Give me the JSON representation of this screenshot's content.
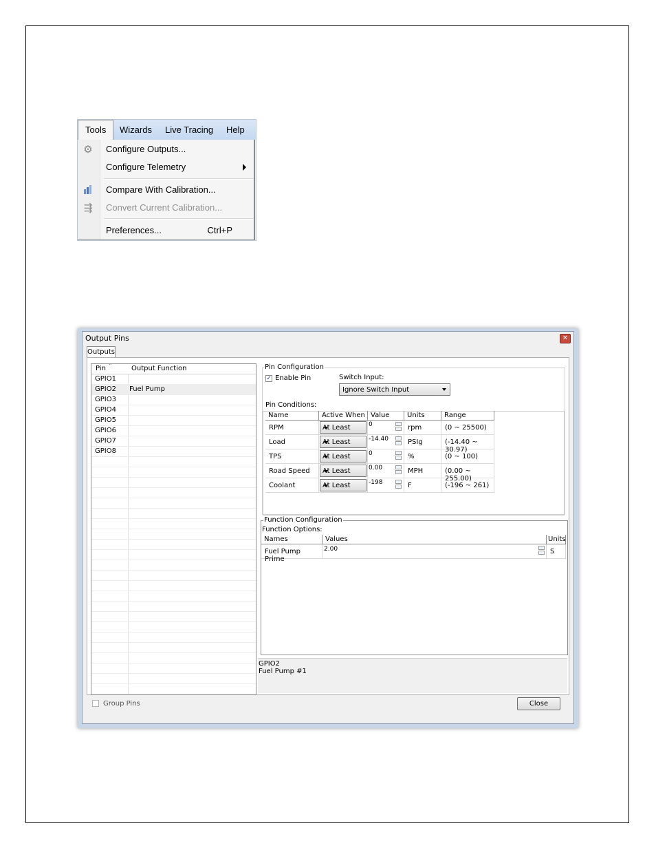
{
  "menu": {
    "bar": [
      "Tools",
      "Wizards",
      "Live Tracing",
      "Help"
    ],
    "items": [
      {
        "label": "Configure Outputs...",
        "icon": "gear-icon",
        "enabled": true
      },
      {
        "label": "Configure Telemetry",
        "submenu": true,
        "enabled": true
      },
      {
        "label": "Compare With Calibration...",
        "icon": "bar-chart-icon",
        "enabled": true
      },
      {
        "label": "Convert Current Calibration...",
        "icon": "convert-icon",
        "enabled": false
      },
      {
        "label": "Preferences...",
        "shortcut": "Ctrl+P",
        "enabled": true
      }
    ]
  },
  "dialog": {
    "title": "Output Pins",
    "tab": "Outputs",
    "pin_table": {
      "headers": [
        "Pin",
        "Output Function"
      ],
      "rows": [
        {
          "pin": "GPIO1",
          "function": ""
        },
        {
          "pin": "GPIO2",
          "function": "Fuel Pump"
        },
        {
          "pin": "GPIO3",
          "function": ""
        },
        {
          "pin": "GPIO4",
          "function": ""
        },
        {
          "pin": "GPIO5",
          "function": ""
        },
        {
          "pin": "GPIO6",
          "function": ""
        },
        {
          "pin": "GPIO7",
          "function": ""
        },
        {
          "pin": "GPIO8",
          "function": ""
        }
      ]
    },
    "pin_config": {
      "title": "Pin Configuration",
      "enable_pin_label": "Enable Pin",
      "switch_input_label": "Switch Input:",
      "switch_input_value": "Ignore Switch Input",
      "pin_conditions_label": "Pin Conditions:",
      "headers": [
        "Name",
        "Active When",
        "Value",
        "Units",
        "Range"
      ],
      "rows": [
        {
          "name": "RPM",
          "active_when": "At Least",
          "value": "0",
          "units": "rpm",
          "range": "(0 ~ 25500)"
        },
        {
          "name": "Load",
          "active_when": "At Least",
          "value": "-14.40",
          "units": "PSIg",
          "range": "(-14.40 ~ 30.97)"
        },
        {
          "name": "TPS",
          "active_when": "At Least",
          "value": "0",
          "units": "%",
          "range": "(0 ~ 100)"
        },
        {
          "name": "Road Speed",
          "active_when": "At Least",
          "value": "0.00",
          "units": "MPH",
          "range": "(0.00 ~ 255.00)"
        },
        {
          "name": "Coolant",
          "active_when": "At Least",
          "value": "-198",
          "units": "F",
          "range": "(-196 ~ 261)"
        }
      ]
    },
    "function_config": {
      "title": "Function Configuration",
      "options_label": "Function Options:",
      "headers": [
        "Names",
        "Values",
        "Units"
      ],
      "rows": [
        {
          "name": "Fuel Pump Prime",
          "value": "2.00",
          "units": "S"
        }
      ]
    },
    "status": {
      "line1": "GPIO2",
      "line2": "Fuel Pump #1"
    },
    "group_pins_label": "Group Pins",
    "close_label": "Close"
  }
}
